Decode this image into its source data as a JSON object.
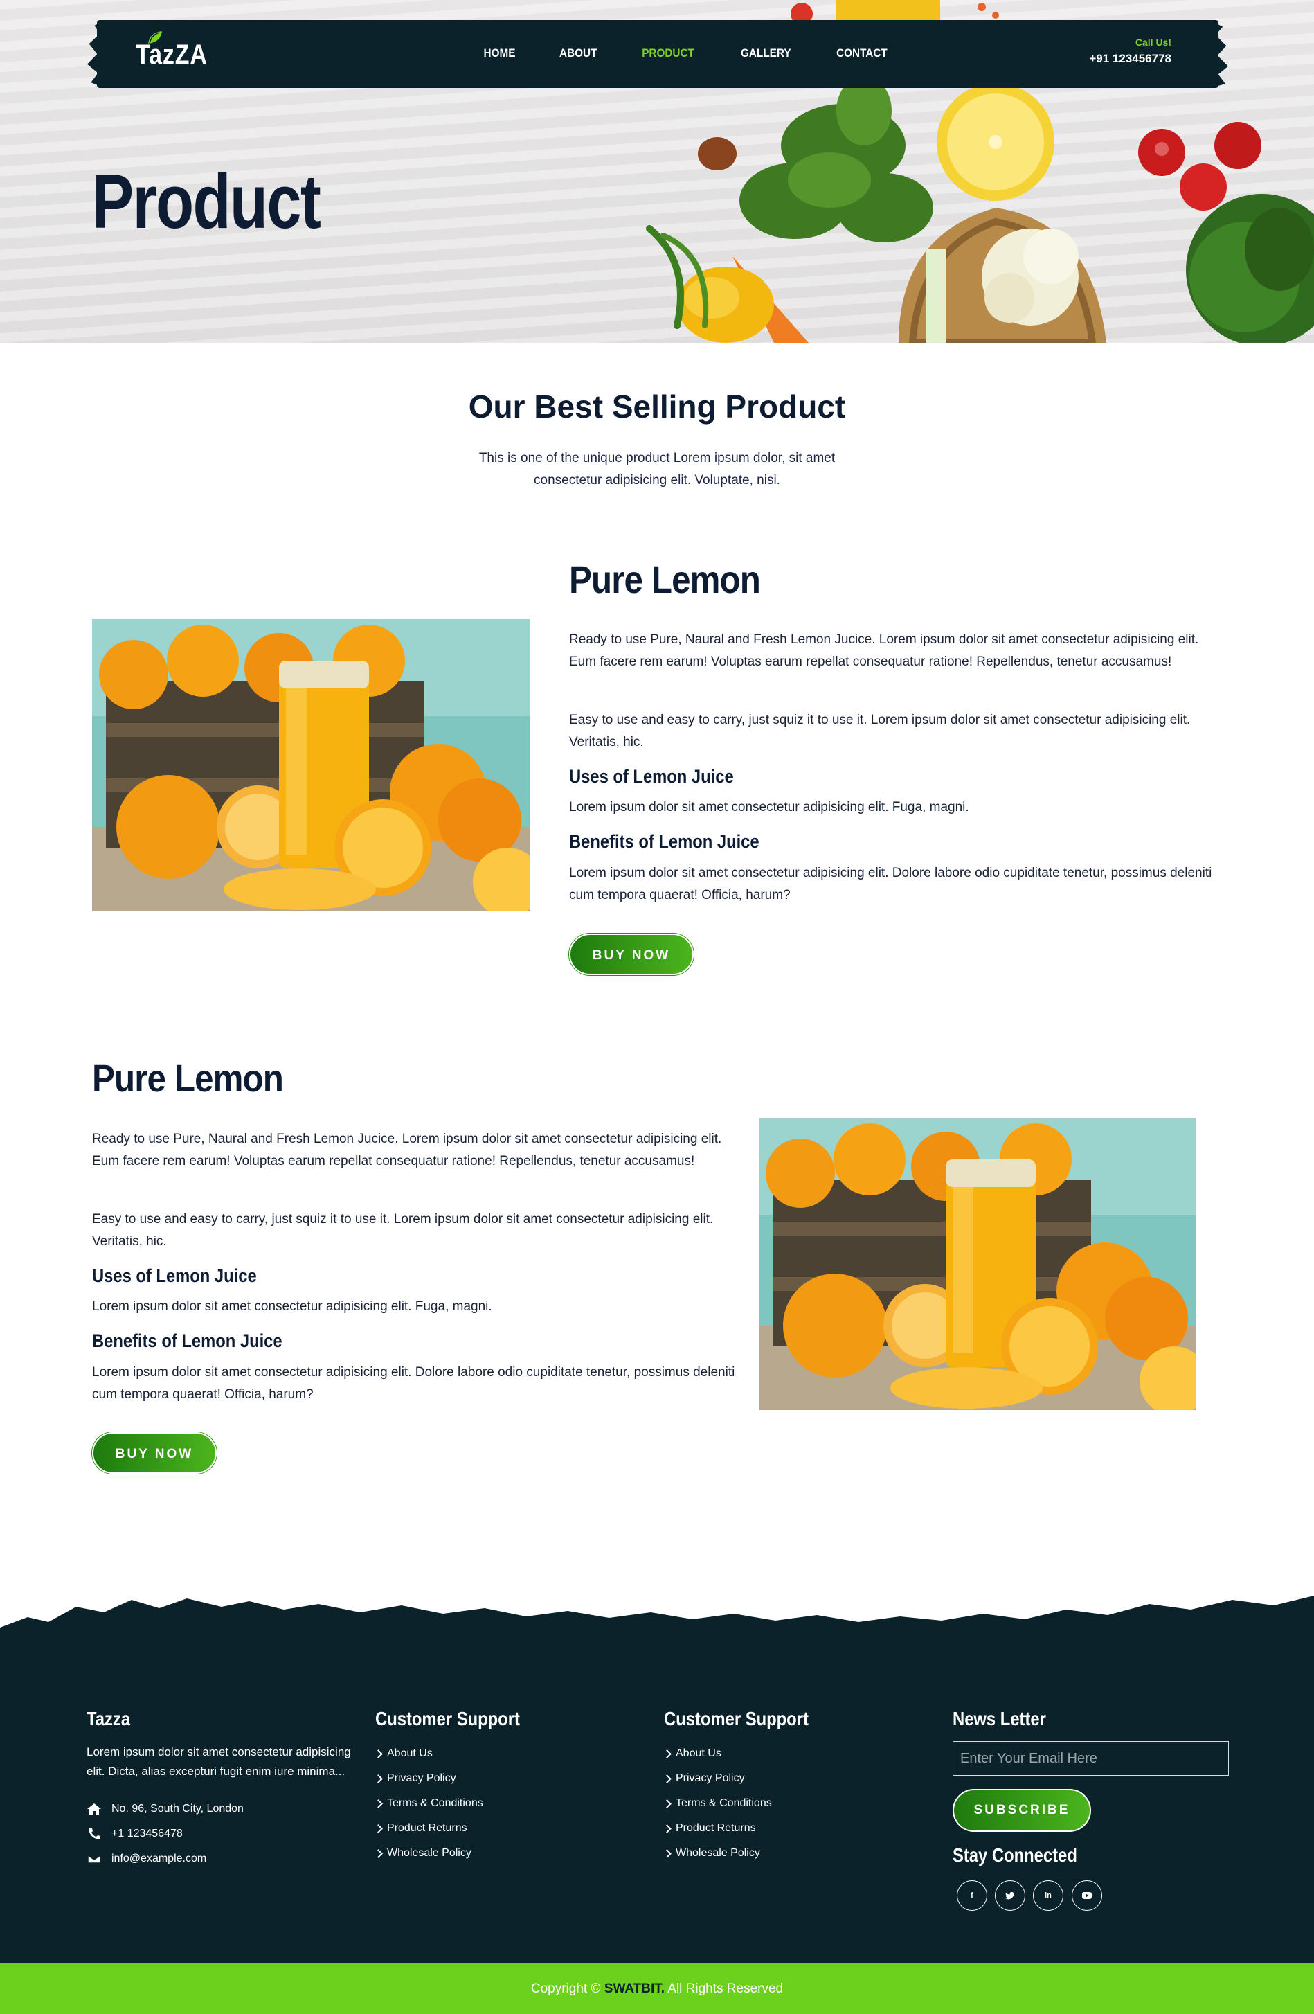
{
  "brand": {
    "name": "TazZA"
  },
  "nav": {
    "items": [
      {
        "label": "HOME",
        "active": false
      },
      {
        "label": "ABOUT",
        "active": false
      },
      {
        "label": "PRODUCT",
        "active": true
      },
      {
        "label": "GALLERY",
        "active": false
      },
      {
        "label": "CONTACT",
        "active": false
      }
    ],
    "call_label": "Call Us!",
    "phone": "+91 123456778"
  },
  "hero": {
    "title": "Product"
  },
  "section": {
    "title": "Our Best Selling Product",
    "subtitle": "This is one of the unique product Lorem ipsum dolor, sit amet consectetur adipisicing elit. Voluptate, nisi."
  },
  "products": [
    {
      "title": "Pure Lemon",
      "p1": "Ready to use Pure, Naural and Fresh Lemon Jucice. Lorem ipsum dolor sit amet consectetur adipisicing elit. Eum facere rem earum! Voluptas earum repellat consequatur ratione! Repellendus, tenetur accusamus!",
      "p2": "Easy to use and easy to carry, just squiz it to use it. Lorem ipsum dolor sit amet consectetur adipisicing elit. Veritatis, hic.",
      "uses_title": "Uses of Lemon Juice",
      "uses_text": "Lorem ipsum dolor sit amet consectetur adipisicing elit. Fuga, magni.",
      "benefits_title": "Benefits of Lemon Juice",
      "benefits_text": "Lorem ipsum dolor sit amet consectetur adipisicing elit. Dolore labore odio cupiditate tenetur, possimus deleniti cum tempora quaerat! Officia, harum?",
      "button": "BUY NOW"
    },
    {
      "title": "Pure Lemon",
      "p1": "Ready to use Pure, Naural and Fresh Lemon Jucice. Lorem ipsum dolor sit amet consectetur adipisicing elit. Eum facere rem earum! Voluptas earum repellat consequatur ratione! Repellendus, tenetur accusamus!",
      "p2": "Easy to use and easy to carry, just squiz it to use it. Lorem ipsum dolor sit amet consectetur adipisicing elit. Veritatis, hic.",
      "uses_title": "Uses of Lemon Juice",
      "uses_text": "Lorem ipsum dolor sit amet consectetur adipisicing elit. Fuga, magni.",
      "benefits_title": "Benefits of Lemon Juice",
      "benefits_text": "Lorem ipsum dolor sit amet consectetur adipisicing elit. Dolore labore odio cupiditate tenetur, possimus deleniti cum tempora quaerat! Officia, harum?",
      "button": "BUY NOW"
    }
  ],
  "footer": {
    "about": {
      "title": "Tazza",
      "text": "Lorem ipsum dolor sit amet consectetur adipisicing elit. Dicta, alias excepturi fugit enim iure minima...",
      "address": "No. 96, South City, London",
      "phone": "+1 123456478",
      "email": "info@example.com"
    },
    "support1": {
      "title": "Customer Support",
      "links": [
        "About Us",
        "Privacy Policy",
        "Terms & Conditions",
        "Product Returns",
        "Wholesale Policy"
      ]
    },
    "support2": {
      "title": "Customer Support",
      "links": [
        "About Us",
        "Privacy Policy",
        "Terms & Conditions",
        "Product Returns",
        "Wholesale Policy"
      ]
    },
    "newsletter": {
      "title": "News Letter",
      "placeholder": "Enter Your Email Here",
      "button": "SUBSCRIBE",
      "stay_title": "Stay Connected",
      "social": [
        "facebook-icon",
        "twitter-icon",
        "linkedin-icon",
        "youtube-icon"
      ]
    },
    "copyright_prefix": "Copyright ©",
    "copyright_brand": "SWATBIT.",
    "copyright_suffix": "All Rights Reserved"
  },
  "colors": {
    "dark": "#0b222a",
    "accent": "#7ed321",
    "green": "#1e7a0e",
    "bar": "#6bd11c",
    "heading": "#0d1b33"
  }
}
